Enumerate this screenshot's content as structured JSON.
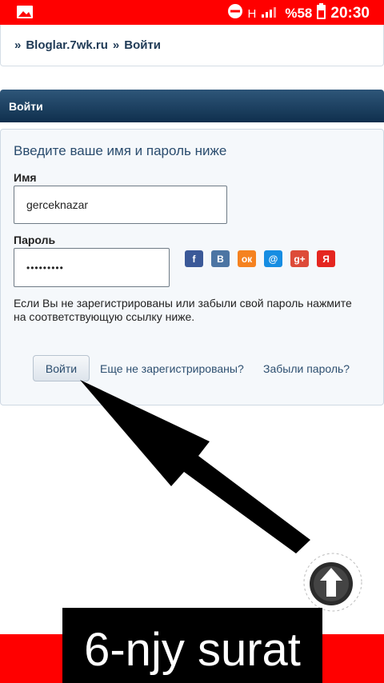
{
  "status_bar": {
    "network": "H",
    "battery_pct": "%58",
    "time": "20:30",
    "icons": [
      "image-icon",
      "do-not-disturb-icon",
      "signal-icon",
      "battery-icon"
    ]
  },
  "breadcrumb": {
    "sep": "»",
    "site": "Bloglar.7wk.ru",
    "page": "Войти"
  },
  "title_bar": {
    "title": "Войти"
  },
  "login_form": {
    "heading": "Введите ваше имя и пароль ниже",
    "name_label": "Имя",
    "name_value": "gerceknazar",
    "password_label": "Пароль",
    "password_value": "•••••••••",
    "social": [
      {
        "name": "facebook-icon",
        "glyph": "f",
        "color": "#3b5998"
      },
      {
        "name": "vkontakte-icon",
        "glyph": "B",
        "color": "#4c75a3"
      },
      {
        "name": "odnoklassniki-icon",
        "glyph": "ок",
        "color": "#f58220"
      },
      {
        "name": "mailru-icon",
        "glyph": "@",
        "color": "#168de2"
      },
      {
        "name": "google-plus-icon",
        "glyph": "g+",
        "color": "#dd4b39"
      },
      {
        "name": "yandex-icon",
        "glyph": "Я",
        "color": "#e52620"
      }
    ],
    "help_text": "Если Вы не зарегистрированы или забыли свой пароль нажмите на соответствующую ссылку ниже.",
    "submit_label": "Войти",
    "register_link": "Еще не зарегистрированы?",
    "forgot_link": "Забыли пароль?"
  },
  "overlay": {
    "caption": "6-njy surat",
    "accent": "#ff0000"
  }
}
